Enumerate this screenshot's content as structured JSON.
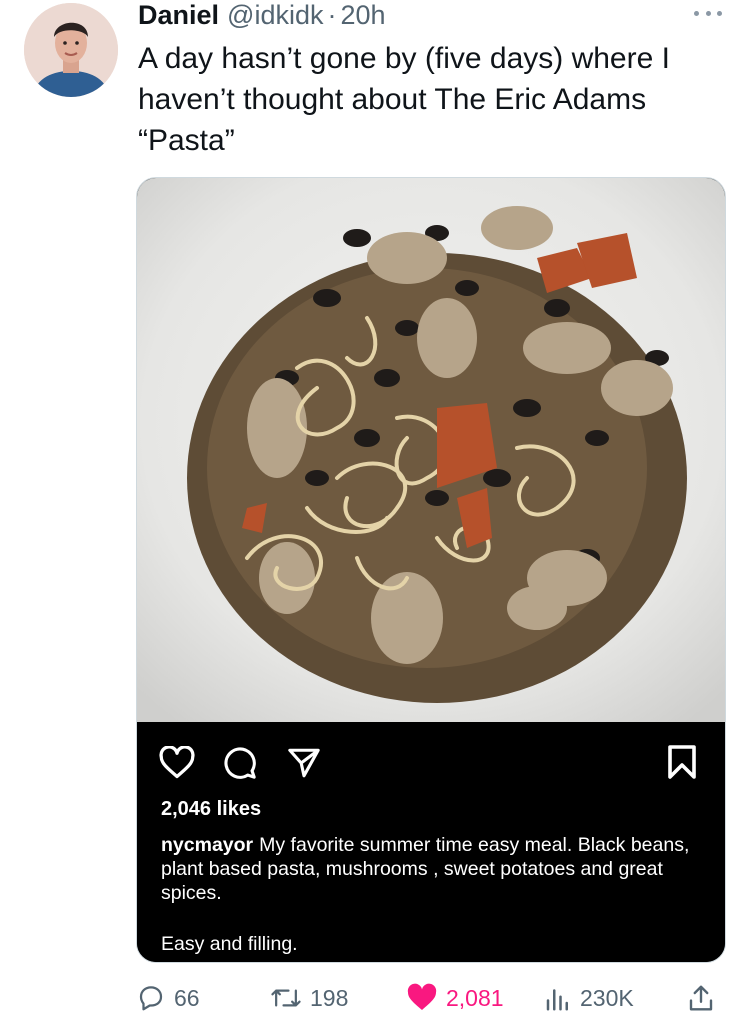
{
  "author": {
    "display_name": "Daniel",
    "handle": "@idkidk",
    "separator": "·",
    "time": "20h"
  },
  "tweet": {
    "text": "A day hasn’t gone by (five days) where I haven’t thought about The Eric Adams “Pasta”"
  },
  "media": {
    "image_description": "Bowl of noodles with black beans, mushrooms and sweet potatoes",
    "instagram": {
      "likes": "2,046 likes",
      "caption_user": "nycmayor",
      "caption_text": "My favorite summer time easy meal. Black beans, plant based pasta, mushrooms , sweet potatoes and great spices.",
      "caption_second": "Easy and filling."
    }
  },
  "actions": {
    "replies": "66",
    "retweets": "198",
    "likes": "2,081",
    "views": "230K"
  },
  "colors": {
    "text": "#0f1419",
    "secondary": "#536471",
    "like_pink": "#f91880"
  },
  "icons": [
    "more-icon",
    "heart-icon",
    "comment-icon",
    "send-icon",
    "bookmark-icon",
    "reply-icon",
    "retweet-icon",
    "like-icon",
    "views-icon",
    "share-icon"
  ]
}
